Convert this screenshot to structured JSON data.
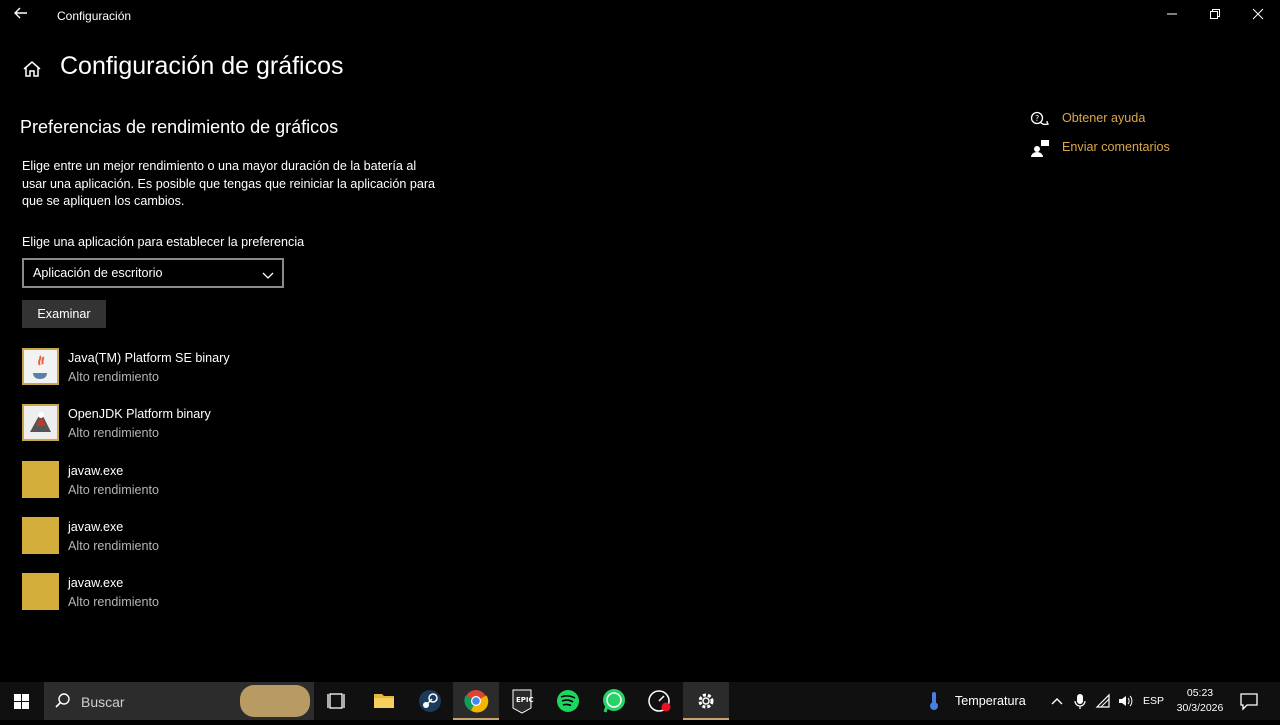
{
  "window": {
    "title": "Configuración",
    "back_icon": "back-arrow-icon",
    "controls": [
      "minimize-icon",
      "restore-icon",
      "close-icon"
    ]
  },
  "header": {
    "home_icon": "home-icon",
    "title": "Configuración de gráficos"
  },
  "section": {
    "title": "Preferencias de rendimiento de gráficos",
    "description": "Elige entre un mejor rendimiento o una mayor duración de la batería al usar una aplicación. Es posible que tengas que reiniciar la aplicación para que se apliquen los cambios.",
    "choose_label": "Elige una aplicación para establecer la preferencia",
    "dropdown_value": "Aplicación de escritorio",
    "browse_label": "Examinar"
  },
  "apps": [
    {
      "name": "Java(TM) Platform SE binary",
      "preference": "Alto rendimiento",
      "icon": "java-icon"
    },
    {
      "name": "OpenJDK Platform binary",
      "preference": "Alto rendimiento",
      "icon": "openjdk-icon"
    },
    {
      "name": "javaw.exe",
      "preference": "Alto rendimiento",
      "icon": "generic-app-icon"
    },
    {
      "name": "javaw.exe",
      "preference": "Alto rendimiento",
      "icon": "generic-app-icon"
    },
    {
      "name": "javaw.exe",
      "preference": "Alto rendimiento",
      "icon": "generic-app-icon"
    }
  ],
  "side_links": {
    "help": "Obtener ayuda",
    "feedback": "Enviar comentarios"
  },
  "taskbar": {
    "search_placeholder": "Buscar",
    "pinned": [
      "task-view-icon",
      "file-explorer-icon",
      "steam-icon",
      "chrome-icon",
      "epic-games-icon",
      "spotify-icon",
      "whatsapp-icon",
      "speedtest-icon",
      "settings-icon"
    ],
    "weather_label": "Temperatura",
    "language": "ESP",
    "time": "05:23",
    "date": "30/3/2026"
  },
  "colors": {
    "accent": "#d9a84a",
    "app_tile": "#d4ae3a",
    "taskbar_active_underline": "#c7a36d"
  }
}
